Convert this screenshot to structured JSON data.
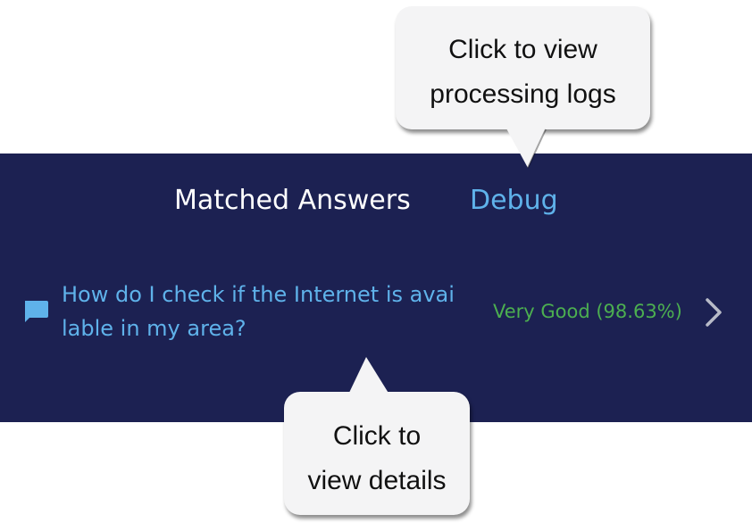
{
  "tabs": {
    "matched_answers": "Matched Answers",
    "debug": "Debug"
  },
  "answer": {
    "question": "How do I check if the Internet is available in my area?",
    "score": "Very Good (98.63%)",
    "icon": "chat-bubble-icon",
    "chevron_icon": "chevron-right-icon"
  },
  "callouts": {
    "debug_hint_line1": "Click to view",
    "debug_hint_line2": "processing logs",
    "details_hint_line1": "Click to",
    "details_hint_line2": "view details"
  },
  "colors": {
    "panel_bg": "#1c2152",
    "accent_link": "#5fb2ea",
    "score_good": "#4caf50",
    "callout_bg": "#f4f4f5"
  }
}
